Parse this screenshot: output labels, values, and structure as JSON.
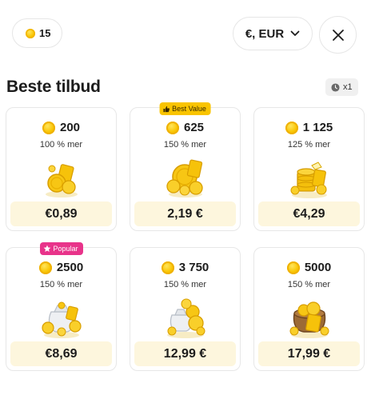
{
  "header": {
    "balance": "15",
    "currency": "€, EUR"
  },
  "section": {
    "title": "Beste tilbud",
    "timer": "x1"
  },
  "offers": [
    {
      "amount": "200",
      "bonus": "100 % mer",
      "price": "€0,89",
      "badge": ""
    },
    {
      "amount": "625",
      "bonus": "150 % mer",
      "price": "2,19 €",
      "badge": "Best Value"
    },
    {
      "amount": "1 125",
      "bonus": "125 % mer",
      "price": "€4,29",
      "badge": ""
    },
    {
      "amount": "2500",
      "bonus": "150 % mer",
      "price": "€8,69",
      "badge": "Popular"
    },
    {
      "amount": "3 750",
      "bonus": "150 % mer",
      "price": "12,99 €",
      "badge": ""
    },
    {
      "amount": "5000",
      "bonus": "150 % mer",
      "price": "17,99 €",
      "badge": ""
    }
  ],
  "colors": {
    "coin": "#f9c400",
    "price_bg": "#fdf6dd",
    "best_value": "#f9c400",
    "popular": "#e8338a"
  },
  "icons": {
    "close": "close-icon",
    "currency_dropdown": "chevron-down-icon",
    "timer": "clock-icon",
    "best_value": "thumbs-up-icon",
    "popular": "star-icon"
  }
}
